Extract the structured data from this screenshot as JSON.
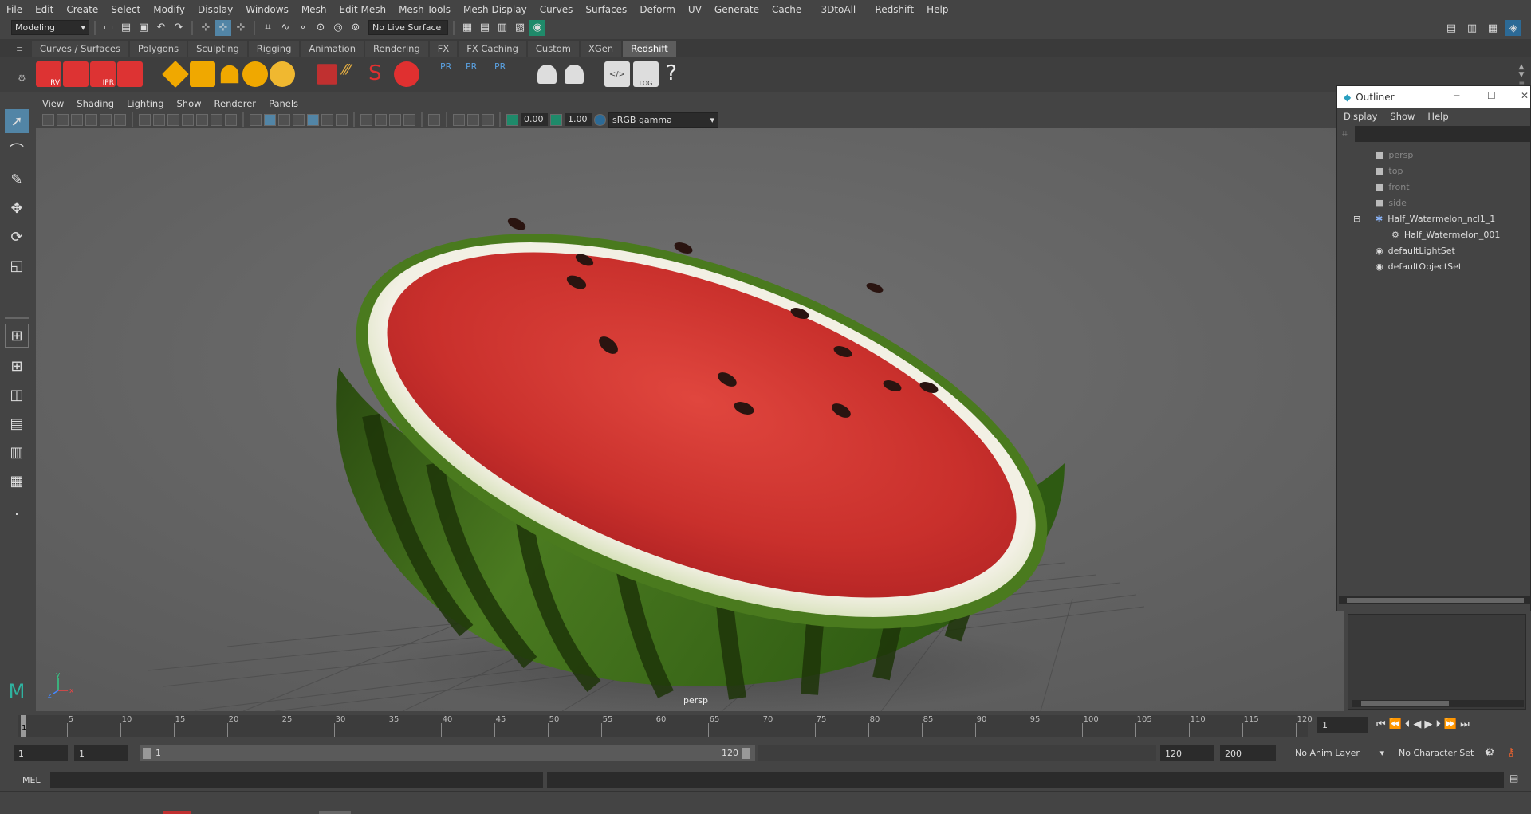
{
  "menubar": {
    "items": [
      "File",
      "Edit",
      "Create",
      "Select",
      "Modify",
      "Display",
      "Windows",
      "Mesh",
      "Edit Mesh",
      "Mesh Tools",
      "Mesh Display",
      "Curves",
      "Surfaces",
      "Deform",
      "UV",
      "Generate",
      "Cache",
      "- 3DtoAll -",
      "Redshift",
      "Help"
    ]
  },
  "status": {
    "workspace_menu": "Modeling",
    "live_surface": "No Live Surface"
  },
  "shelf": {
    "tabs": [
      "Curves / Surfaces",
      "Polygons",
      "Sculpting",
      "Rigging",
      "Animation",
      "Rendering",
      "FX",
      "FX Caching",
      "Custom",
      "XGen",
      "Redshift"
    ],
    "active_tab": "Redshift",
    "icon_labels": {
      "rv": "RV",
      "ipr": "IPR",
      "pr1": "PR",
      "pr2": "PR",
      "pr3": "PR",
      "log": "LOG",
      "help": "?"
    }
  },
  "viewport": {
    "menu": [
      "View",
      "Shading",
      "Lighting",
      "Show",
      "Renderer",
      "Panels"
    ],
    "exposure": "0.00",
    "gamma": "1.00",
    "color_space": "sRGB gamma",
    "camera_label": "persp",
    "axis_x": "x",
    "axis_y": "y",
    "axis_z": "z"
  },
  "outliner": {
    "title": "Outliner",
    "menu": [
      "Display",
      "Show",
      "Help"
    ],
    "items": [
      {
        "label": "persp",
        "dim": true
      },
      {
        "label": "top",
        "dim": true
      },
      {
        "label": "front",
        "dim": true
      },
      {
        "label": "side",
        "dim": true
      },
      {
        "label": "Half_Watermelon_ncl1_1",
        "dim": false
      },
      {
        "label": "Half_Watermelon_001",
        "dim": false
      },
      {
        "label": "defaultLightSet",
        "dim": false
      },
      {
        "label": "defaultObjectSet",
        "dim": false
      }
    ]
  },
  "timeline": {
    "ticks": [
      "5",
      "10",
      "15",
      "20",
      "25",
      "30",
      "35",
      "40",
      "45",
      "50",
      "55",
      "60",
      "65",
      "70",
      "75",
      "80",
      "85",
      "90",
      "95",
      "100",
      "105",
      "110",
      "115",
      "120"
    ],
    "start_marker": "1",
    "current_frame": "1"
  },
  "range": {
    "start_field": "1",
    "start_field2": "1",
    "slider_start": "1",
    "slider_end": "120",
    "end_field": "120",
    "end_field2": "200",
    "anim_layer": "No Anim Layer",
    "character_set": "No Character Set"
  },
  "command": {
    "label": "MEL"
  }
}
